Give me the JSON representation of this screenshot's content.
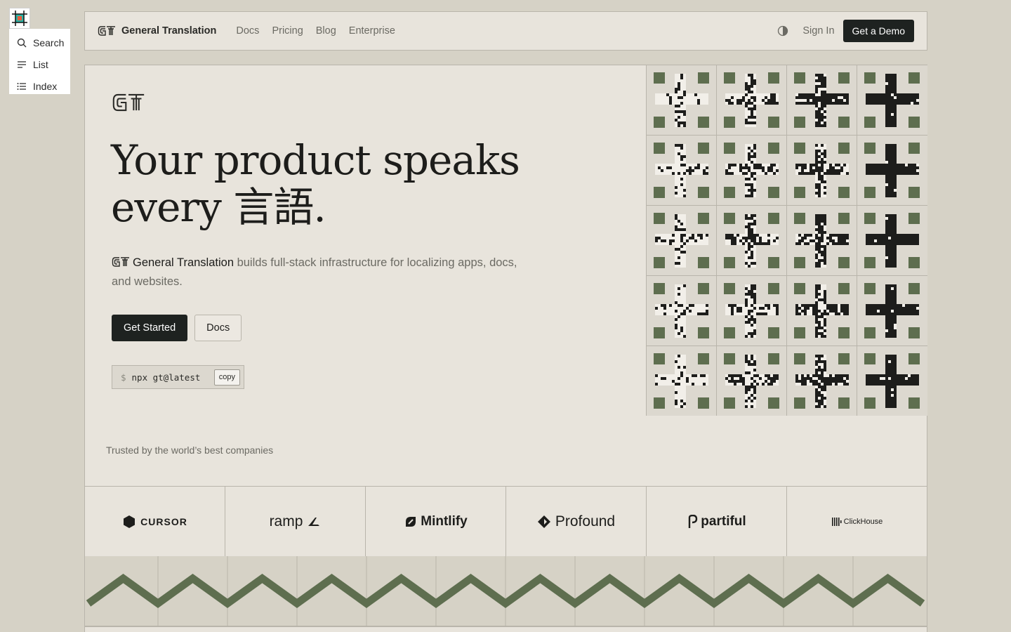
{
  "toolbar": {
    "items": [
      {
        "label": "Search",
        "icon": "search-icon"
      },
      {
        "label": "List",
        "icon": "list-icon"
      },
      {
        "label": "Index",
        "icon": "index-icon"
      }
    ]
  },
  "nav": {
    "brand": "General Translation",
    "links": [
      "Docs",
      "Pricing",
      "Blog",
      "Enterprise"
    ],
    "signin": "Sign In",
    "demo": "Get a Demo"
  },
  "hero": {
    "headline_line1": "Your product speaks",
    "headline_line2": "every 言語.",
    "tagline_brand": "General Translation",
    "tagline_rest": " builds full-stack infrastructure for localizing apps, docs, and websites.",
    "primary_cta": "Get Started",
    "secondary_cta": "Docs",
    "command_prompt": "$",
    "command": "npx gt@latest",
    "copy": "copy"
  },
  "trusted": {
    "heading": "Trusted by the world’s best companies",
    "logos": [
      "CURSOR",
      "ramp",
      "Mintlify",
      "Profound",
      "partiful",
      "ClickHouse"
    ]
  },
  "colors": {
    "accent_green": "#5e6e4f",
    "dark": "#1e2220",
    "background": "#d6d2c6",
    "panel": "#e8e4dc"
  }
}
